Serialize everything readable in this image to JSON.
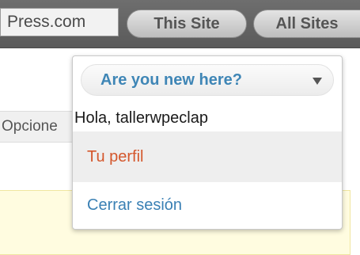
{
  "topbar": {
    "search_value": "Press.com",
    "scope_this_label": "This Site",
    "scope_all_label": "All Sites"
  },
  "page": {
    "option_label": "Opcione"
  },
  "dropdown": {
    "title": "Are you new here?",
    "greeting": "Hola, tallerwpeclap",
    "items": [
      {
        "label": "Tu perfil"
      },
      {
        "label": "Cerrar sesión"
      }
    ]
  },
  "colors": {
    "link_blue": "#3a80b4",
    "profile_orange": "#d4572c",
    "topbar_gray": "#636363"
  }
}
